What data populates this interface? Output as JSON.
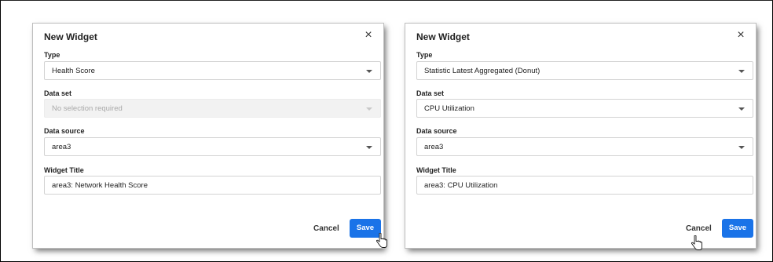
{
  "dialogs": [
    {
      "title": "New Widget",
      "close_glyph": "×",
      "type": {
        "label": "Type",
        "value": "Health Score"
      },
      "dataset": {
        "label": "Data set",
        "value": "No selection required",
        "disabled": true
      },
      "datasource": {
        "label": "Data source",
        "value": "area3"
      },
      "widget_title": {
        "label": "Widget Title",
        "value": "area3: Network Health Score"
      },
      "cancel_label": "Cancel",
      "save_label": "Save"
    },
    {
      "title": "New Widget",
      "close_glyph": "×",
      "type": {
        "label": "Type",
        "value": "Statistic Latest Aggregated (Donut)"
      },
      "dataset": {
        "label": "Data set",
        "value": "CPU Utilization",
        "disabled": false
      },
      "datasource": {
        "label": "Data source",
        "value": "area3"
      },
      "widget_title": {
        "label": "Widget Title",
        "value": "area3: CPU Utilization"
      },
      "cancel_label": "Cancel",
      "save_label": "Save"
    }
  ],
  "colors": {
    "accent": "#1a73e8",
    "disabled_bg": "#f2f2f2",
    "border": "#d3d3d3"
  },
  "icons": {
    "close": "close-icon",
    "dropdown": "chevron-down-icon",
    "cursor": "hand-pointer-icon"
  }
}
